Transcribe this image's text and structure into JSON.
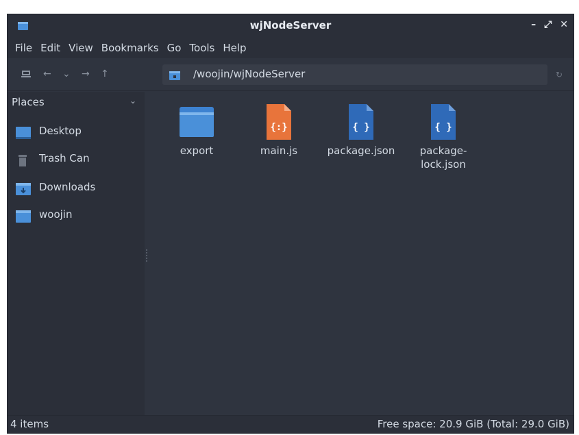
{
  "window": {
    "title": "wjNodeServer",
    "controls": {
      "minimize": "–",
      "maximize": "⤢",
      "close": "✕"
    }
  },
  "menubar": {
    "items": [
      {
        "label": "File"
      },
      {
        "label": "Edit"
      },
      {
        "label": "View"
      },
      {
        "label": "Bookmarks"
      },
      {
        "label": "Go"
      },
      {
        "label": "Tools"
      },
      {
        "label": "Help"
      }
    ]
  },
  "toolbar": {
    "computer_icon": "computer-icon",
    "back_icon": "←",
    "history_icon": "⌄",
    "forward_icon": "→",
    "up_icon": "↑",
    "location_path": "/woojin/wjNodeServer",
    "refresh_icon": "↻"
  },
  "sidebar": {
    "header": "Places",
    "items": [
      {
        "label": "Desktop",
        "icon": "desktop-icon"
      },
      {
        "label": "Trash Can",
        "icon": "trash-icon"
      },
      {
        "label": "Downloads",
        "icon": "downloads-folder-icon"
      },
      {
        "label": "woojin",
        "icon": "home-folder-icon"
      }
    ]
  },
  "files": [
    {
      "name": "export",
      "type": "folder",
      "icon": "folder-icon"
    },
    {
      "name": "main.js",
      "type": "javascript",
      "icon": "javascript-file-icon",
      "glyph": "{:}"
    },
    {
      "name": "package.json",
      "type": "json",
      "icon": "json-file-icon",
      "glyph": "{ }"
    },
    {
      "name": "package-\nlock.json",
      "type": "json",
      "icon": "json-file-icon",
      "glyph": "{ }"
    }
  ],
  "status": {
    "items_count": "4 items",
    "free_space": "Free space: 20.9 GiB (Total: 29.0 GiB)"
  },
  "colors": {
    "folder": "#4a90d9",
    "js_file": "#e8743b",
    "json_file": "#2f6ab8",
    "background": "#2f343f",
    "sidebar": "#2b2f39"
  }
}
